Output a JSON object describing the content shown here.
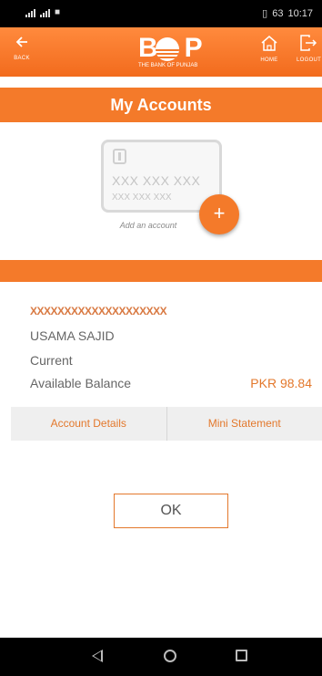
{
  "status_bar": {
    "left_text": "46",
    "battery": "63",
    "time": "10:17"
  },
  "header": {
    "back_label": "BACK",
    "logo_text": "BOP",
    "logo_subtitle": "THE BANK OF PUNJAB",
    "home_label": "HOME",
    "logout_label": "LOGOUT",
    "icons": {
      "back": "arrow-left-icon",
      "home": "home-icon",
      "logout": "logout-icon"
    }
  },
  "title": "My Accounts",
  "card": {
    "number_line1": "XXX XXX XXX",
    "number_line2": "XXX XXX XXX",
    "add_label": "Add an account",
    "add_symbol": "+"
  },
  "account": {
    "number": "XXXXXXXXXXXXXXXXXXXX",
    "name": "USAMA SAJID",
    "type": "Current",
    "balance_label": "Available Balance",
    "balance_value": "PKR 98.84"
  },
  "tabs": [
    "Account Details",
    "Mini Statement"
  ],
  "ok_label": "OK",
  "colors": {
    "accent": "#f47a2a",
    "text": "#666666",
    "tab_bg": "#efefef"
  }
}
